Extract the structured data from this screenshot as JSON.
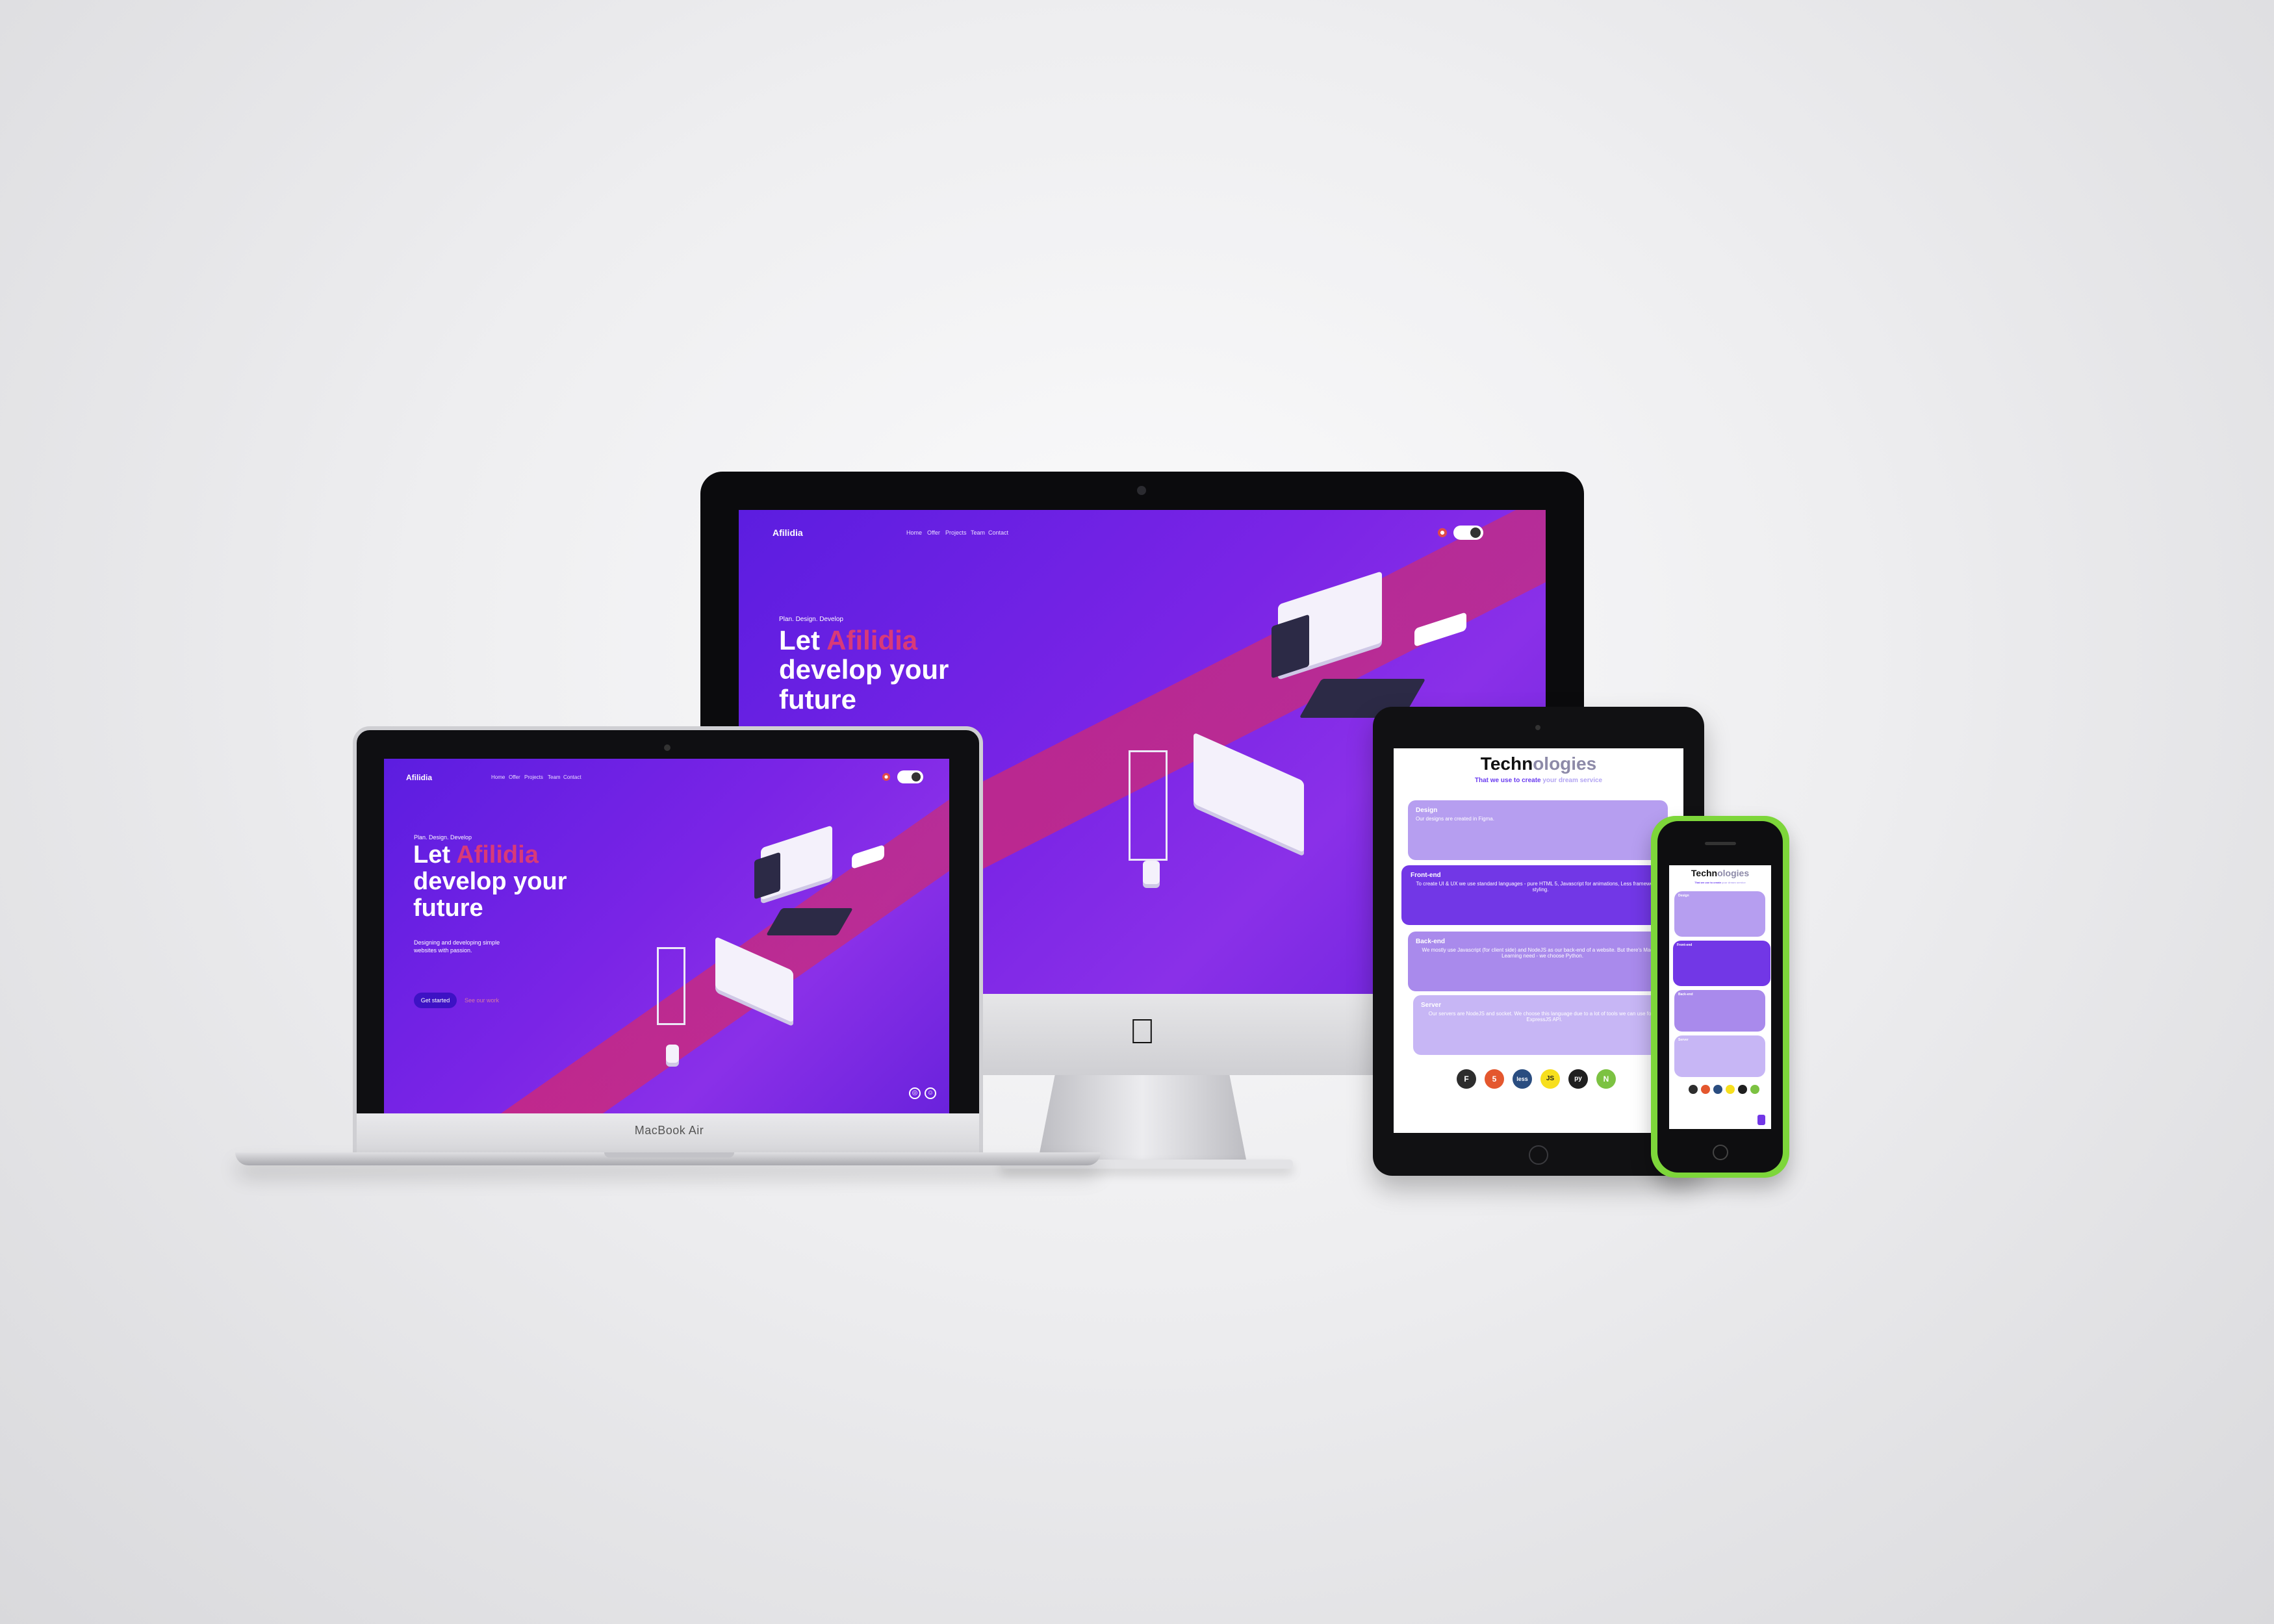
{
  "site": {
    "logo": "Afilidia",
    "nav": [
      "Home",
      "Offer",
      "Projects",
      "Team",
      "Contact"
    ],
    "tagline": "Plan. Design. Develop",
    "hero_prefix": "Let ",
    "hero_brand": "Afilidia",
    "hero_line2": "develop your",
    "hero_line3": "future",
    "description": "Designing and developing simple websites with passion.",
    "cta_primary": "Get started",
    "cta_secondary": "See our work",
    "colors": {
      "accent": "#d83a78",
      "primary": "#7a24e6",
      "button": "#3d12c4"
    }
  },
  "devices": {
    "laptop_brand": "MacBook Air",
    "apple_logo": "apple-icon"
  },
  "technologies": {
    "title_dark": "Techn",
    "title_light": "ologies",
    "subtitle_dark": "That we use to create ",
    "subtitle_light": "your dream service",
    "cards": [
      {
        "title": "Design",
        "text": "Our designs are created in Figma."
      },
      {
        "title": "Front-end",
        "text": "To create UI & UX we use standard languages - pure HTML 5, Javascript for animations, Less framework for styling."
      },
      {
        "title": "Back-end",
        "text": "We mostly use Javascript (for client side) and NodeJS as our back-end of a website. But there's Machine Learning need - we choose Python."
      },
      {
        "title": "Server",
        "text": "Our servers are NodeJS and socket. We choose this language due to a lot of tools we can use for it - ExpressJS API."
      }
    ],
    "logos": [
      "F",
      "5",
      "less",
      "JS",
      "py",
      "N"
    ]
  }
}
